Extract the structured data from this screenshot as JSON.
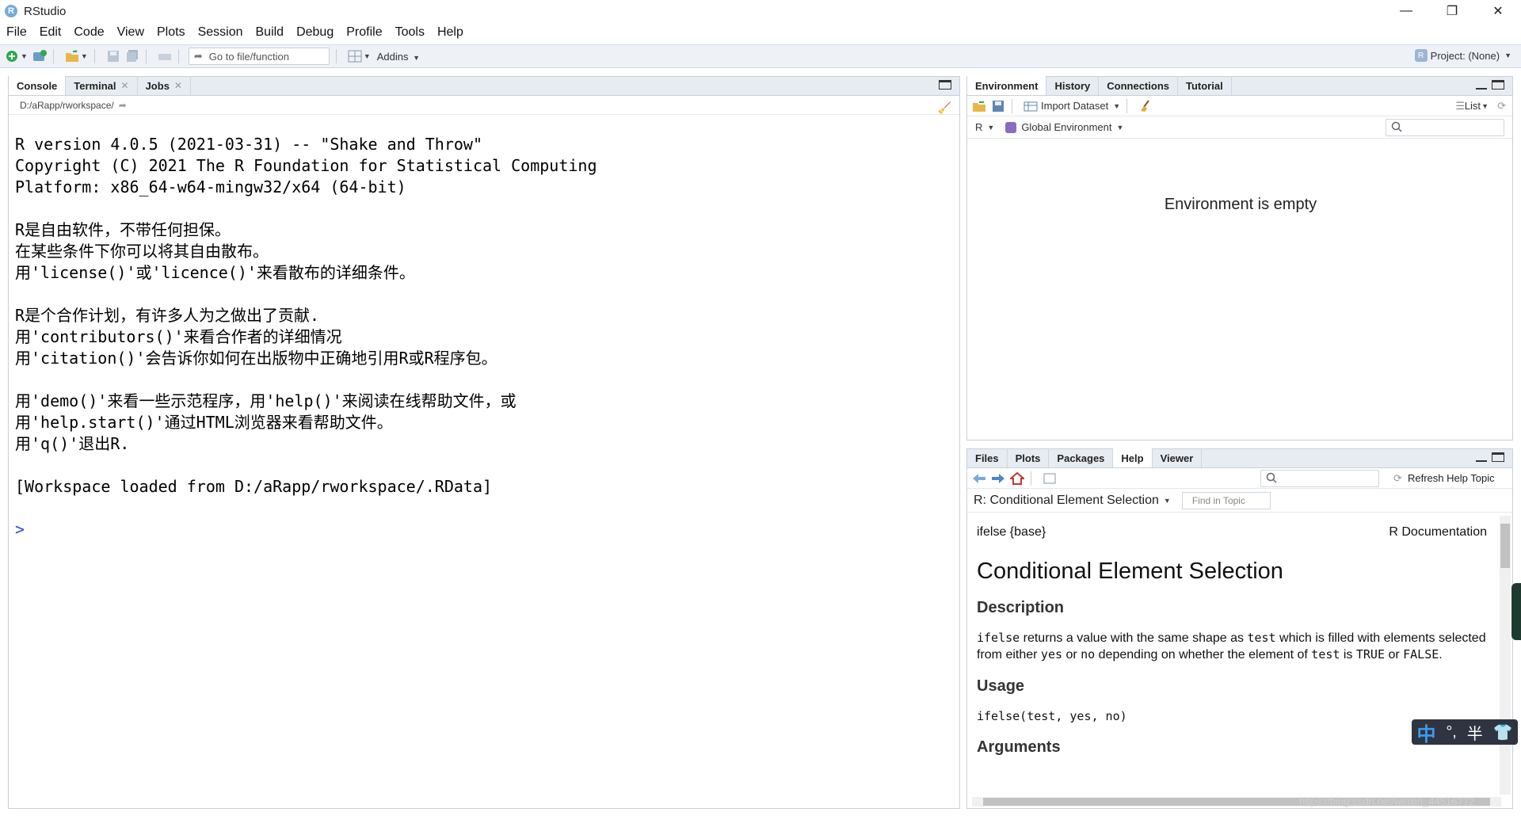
{
  "window": {
    "title": "RStudio",
    "controls": {
      "minimize": "—",
      "maximize": "❐",
      "close": "✕"
    }
  },
  "menu": [
    "File",
    "Edit",
    "Code",
    "View",
    "Plots",
    "Session",
    "Build",
    "Debug",
    "Profile",
    "Tools",
    "Help"
  ],
  "toolbar": {
    "goto_placeholder": "Go to file/function",
    "addins_label": "Addins",
    "project_label": "Project: (None)"
  },
  "console_pane": {
    "tabs": [
      {
        "label": "Console",
        "closable": false
      },
      {
        "label": "Terminal",
        "closable": true
      },
      {
        "label": "Jobs",
        "closable": true
      }
    ],
    "path": "D:/aRapp/rworkspace/",
    "lines": [
      "R version 4.0.5 (2021-03-31) -- \"Shake and Throw\"",
      "Copyright (C) 2021 The R Foundation for Statistical Computing",
      "Platform: x86_64-w64-mingw32/x64 (64-bit)",
      "",
      "R是自由软件，不带任何担保。",
      "在某些条件下你可以将其自由散布。",
      "用'license()'或'licence()'来看散布的详细条件。",
      "",
      "R是个合作计划，有许多人为之做出了贡献.",
      "用'contributors()'来看合作者的详细情况",
      "用'citation()'会告诉你如何在出版物中正确地引用R或R程序包。",
      "",
      "用'demo()'来看一些示范程序，用'help()'来阅读在线帮助文件，或",
      "用'help.start()'通过HTML浏览器来看帮助文件。",
      "用'q()'退出R.",
      "",
      "[Workspace loaded from D:/aRapp/rworkspace/.RData]",
      ""
    ],
    "prompt": ">"
  },
  "env_pane": {
    "tabs": [
      "Environment",
      "History",
      "Connections",
      "Tutorial"
    ],
    "import_label": "Import Dataset",
    "list_label": "List",
    "lang_label": "R",
    "scope_label": "Global Environment",
    "empty_message": "Environment is empty"
  },
  "help_pane": {
    "tabs": [
      "Files",
      "Plots",
      "Packages",
      "Help",
      "Viewer"
    ],
    "refresh_label": "Refresh Help Topic",
    "topic_label": "R: Conditional Element Selection",
    "find_placeholder": "Find in Topic",
    "doc": {
      "left_header": "ifelse {base}",
      "right_header": "R Documentation",
      "title": "Conditional Element Selection",
      "description_heading": "Description",
      "desc": {
        "c1": "ifelse",
        "t1": " returns a value with the same shape as ",
        "c2": "test",
        "t2": " which is filled with elements selected from either ",
        "c3": "yes",
        "t3": " or ",
        "c4": "no",
        "t4": " depending on whether the element of ",
        "c5": "test",
        "t5": " is ",
        "c6": "TRUE",
        "t6": " or ",
        "c7": "FALSE",
        "t7": "."
      },
      "usage_heading": "Usage",
      "usage_code": "ifelse(test, yes, no)",
      "arguments_heading": "Arguments"
    }
  },
  "ime": {
    "lang": "中",
    "punct": "°,",
    "width": "半",
    "skin": "👕"
  },
  "watermark": "https://blog.csdn.net/weixin_44516772"
}
